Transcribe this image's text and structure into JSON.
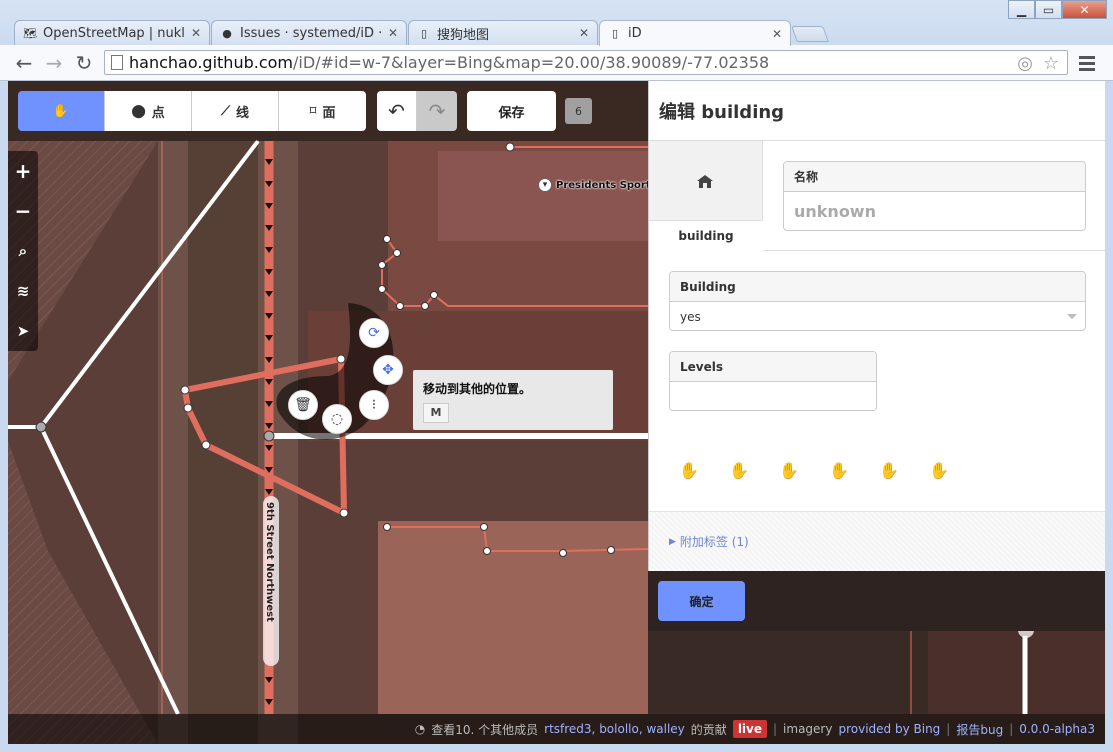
{
  "browser": {
    "tabs": [
      {
        "title": "OpenStreetMap | nukle",
        "active": false
      },
      {
        "title": "Issues · systemed/iD · G",
        "active": false
      },
      {
        "title": "搜狗地图",
        "active": false
      },
      {
        "title": "iD",
        "active": true
      }
    ],
    "url_host": "hanchao.github.com",
    "url_path": "/iD/#id=w-7&layer=Bing&map=20.00/38.90089/-77.02358"
  },
  "toolbar": {
    "modes": {
      "browse": "",
      "point": "点",
      "line": "线",
      "area": "面"
    },
    "save_label": "保存",
    "save_count": "6"
  },
  "map": {
    "poi_label": "Presidents Sports",
    "street_label": "9th Street Northwest",
    "street_label2": "hwest",
    "tooltip": {
      "text": "移动到其他的位置。",
      "key": "M"
    }
  },
  "footer": {
    "view_prefix": "查看10. 个其他成员",
    "contributors": "rtsfred3, bolollo, walley",
    "view_suffix": "的贡献",
    "live": "live",
    "imagery_prefix": "imagery",
    "imagery_link": "provided by Bing",
    "report_bug": "报告bug",
    "version": "0.0.0-alpha3"
  },
  "inspector": {
    "title": "编辑 building",
    "preset_label": "building",
    "fields": {
      "name_label": "名称",
      "name_placeholder": "unknown",
      "building_label": "Building",
      "building_value": "yes",
      "levels_label": "Levels",
      "levels_value": ""
    },
    "tags_toggle": "附加标签 (1)",
    "ok_label": "确定"
  },
  "colors": {
    "accent": "#7092ff",
    "selected_way": "#e06e5f",
    "live_badge": "#cc3333"
  }
}
